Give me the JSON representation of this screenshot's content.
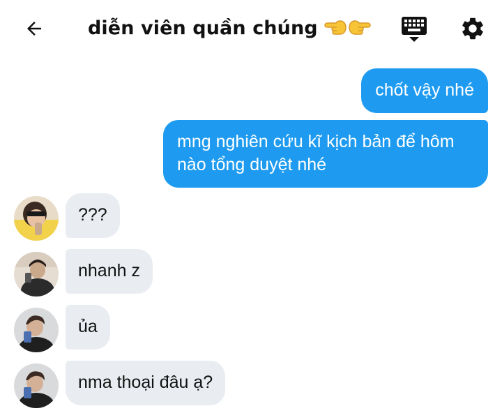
{
  "header": {
    "back_icon": "arrow-left-icon",
    "title": "diễn viên quần chúng",
    "title_emoji": [
      "backhand-index-pointing-left",
      "backhand-index-pointing-right"
    ],
    "keyboard_icon": "keyboard-icon",
    "settings_icon": "gear-icon"
  },
  "messages": [
    {
      "side": "outgoing",
      "text": "chốt vậy nhé"
    },
    {
      "side": "outgoing",
      "text": "mng nghiên cứu kĩ kịch bản để hôm nào tổng duyệt nhé"
    },
    {
      "side": "incoming",
      "text": "???"
    },
    {
      "side": "incoming",
      "text": "nhanh z"
    },
    {
      "side": "incoming",
      "text": "ủa"
    },
    {
      "side": "incoming",
      "text": "nma thoại đâu ạ?"
    }
  ],
  "colors": {
    "outgoing_bubble": "#1e9bf0",
    "incoming_bubble": "#e9edf1",
    "background": "#ffffff"
  }
}
